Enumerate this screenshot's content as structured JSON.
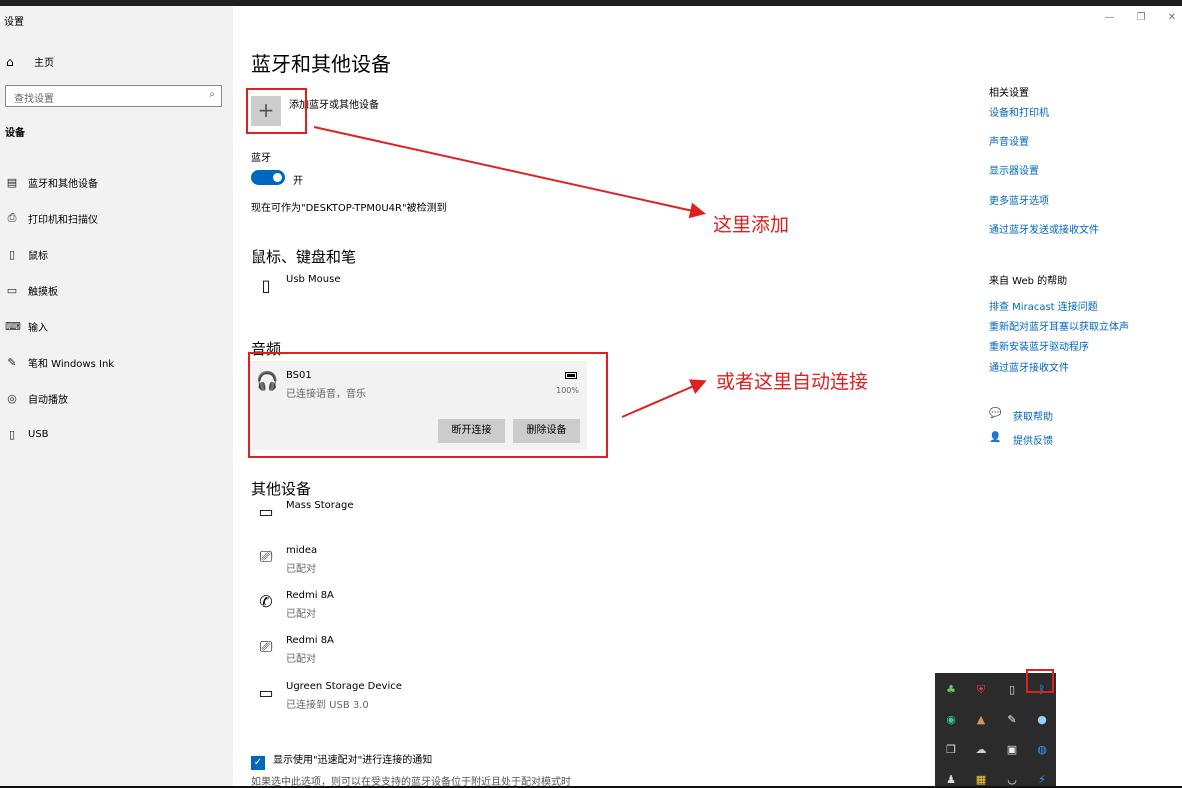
{
  "window": {
    "title": "设置"
  },
  "sidebar": {
    "home": "主页",
    "search_placeholder": "查找设置",
    "section": "设备",
    "items": [
      {
        "label": "蓝牙和其他设备",
        "icon": "bluetooth-devices-icon"
      },
      {
        "label": "打印机和扫描仪",
        "icon": "printer-icon"
      },
      {
        "label": "鼠标",
        "icon": "mouse-icon"
      },
      {
        "label": "触摸板",
        "icon": "touchpad-icon"
      },
      {
        "label": "输入",
        "icon": "keyboard-icon"
      },
      {
        "label": "笔和 Windows Ink",
        "icon": "pen-icon"
      },
      {
        "label": "自动播放",
        "icon": "autoplay-icon"
      },
      {
        "label": "USB",
        "icon": "usb-icon"
      }
    ]
  },
  "main": {
    "title": "蓝牙和其他设备",
    "add_label": "添加蓝牙或其他设备",
    "bluetooth_label": "蓝牙",
    "bluetooth_state": "开",
    "discoverable": "现在可作为\"DESKTOP-TPM0U4R\"被检测到",
    "mouse_section": "鼠标、键盘和笔",
    "mouse_device": "Usb Mouse",
    "audio_section": "音频",
    "audio_device": {
      "name": "BS01",
      "status": "已连接语音，音乐",
      "battery": "100%",
      "disconnect": "断开连接",
      "remove": "删除设备"
    },
    "other_section": "其他设备",
    "other_devices": [
      {
        "name": "Mass Storage",
        "status": ""
      },
      {
        "name": "midea",
        "status": "已配对"
      },
      {
        "name": "Redmi 8A",
        "status": "已配对"
      },
      {
        "name": "Redmi 8A",
        "status": "已配对"
      },
      {
        "name": "Ugreen Storage Device",
        "status": "已连接到 USB 3.0"
      }
    ],
    "swift_pair": "显示使用\"迅速配对\"进行连接的通知",
    "swift_pair_desc": "如果选中此选项，则可以在受支持的蓝牙设备位于附近且处于配对模式时"
  },
  "annotations": {
    "add_here": "这里添加",
    "auto_connect": "或者这里自动连接"
  },
  "related": {
    "title": "相关设置",
    "links": [
      "设备和打印机",
      "声音设置",
      "显示器设置",
      "更多蓝牙选项",
      "通过蓝牙发送或接收文件"
    ]
  },
  "help": {
    "title": "来自 Web 的帮助",
    "links": [
      "排查 Miracast 连接问题",
      "重新配对蓝牙耳塞以获取立体声",
      "重新安装蓝牙驱动程序",
      "通过蓝牙接收文件"
    ],
    "get_help": "获取帮助",
    "feedback": "提供反馈"
  },
  "colors": {
    "accent": "#0067c0",
    "annotation": "#e02020"
  }
}
